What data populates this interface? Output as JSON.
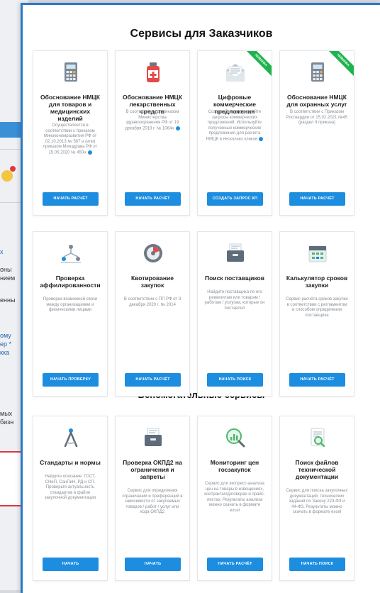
{
  "background": {
    "fragments": [
      "х",
      "оны",
      "нием",
      "енны",
      "ому",
      "ер *",
      "кка",
      "мых",
      "бизн"
    ]
  },
  "sections": {
    "main_title": "Сервисы для Заказчиков",
    "aux_title": "Вспомогательные сервисы"
  },
  "cards": [
    {
      "title": "Обоснование НМЦК для товаров и медицинских изделий",
      "desc": "Осуществляется в соответствии с приказом Минэкономразвития РФ от 02.10.2013 № 567 и (или) приказом Минздрава РФ от 15.05.2020 № 450н",
      "button": "НАЧАТЬ РАСЧЁТ",
      "icon": "calculator-icon",
      "ribbon": ""
    },
    {
      "title": "Обоснование НМЦК лекарственных средств",
      "desc": "В соответствии с приказом Министерства здравоохранения РФ от 19 декабря 2019 г. № 1064н",
      "button": "НАЧАТЬ РАСЧЁТ",
      "icon": "medicine-bottle-icon",
      "ribbon": ""
    },
    {
      "title": "Цифровые коммерческие предложения",
      "desc": "Создавайте и отправляйте запросы коммерческих предложений. Используйте полученные коммерческие предложения для расчета НМЦК в несколько кликов",
      "button": "СОЗДАТЬ ЗАПРОС КП",
      "icon": "envelope-icon",
      "ribbon": "НОВИНКА"
    },
    {
      "title": "Обоснование НМЦК для охранных услуг",
      "desc": "В соответствии с Приказом Росгвардии от 15.02.2021 №45 (раздел II приказа)",
      "button": "НАЧАТЬ РАСЧЁТ",
      "icon": "calculator-icon",
      "ribbon": "НОВИНКА"
    },
    {
      "title": "Проверка аффилированности",
      "desc": "Проверка возможной связи между организациями и физическими лицами",
      "button": "НАЧАТЬ ПРОВЕРКУ",
      "icon": "network-icon",
      "ribbon": ""
    },
    {
      "title": "Квотирование закупок",
      "desc": "В соответствии с ПП РФ от 3 декабря 2020 г. № 2014",
      "button": "НАЧАТЬ РАСЧЁТ",
      "icon": "pie-chart-icon",
      "ribbon": ""
    },
    {
      "title": "Поиск поставщиков",
      "desc": "Найдите поставщика по его реквизитам или товарам / работам / услугам, которые он поставлял",
      "button": "НАЧАТЬ ПОИСК",
      "icon": "file-box-icon",
      "ribbon": ""
    },
    {
      "title": "Калькулятор сроков закупки",
      "desc": "Сервис расчёта сроков закупки в соответствии с регламентом и способом определения поставщика",
      "button": "НАЧАТЬ РАСЧЁТ",
      "icon": "calendar-icon",
      "ribbon": ""
    },
    {
      "title": "Стандарты и нормы",
      "desc": "Найдите описание: ГОСТ, СНиП, СанПиН, РД и СП. Проверьте актуальность стандартов в файле закупочной документации",
      "button": "НАЧАТЬ",
      "icon": "compass-icon",
      "ribbon": ""
    },
    {
      "title": "Проверка ОКПД2 на ограничения и запреты",
      "desc": "Сервис для определения ограничений и преференций в зависимости от закупаемых товаров / работ / услуг или кода ОКПД2",
      "button": "НАЧАТЬ",
      "icon": "file-box-icon",
      "ribbon": ""
    },
    {
      "title": "Мониторинг цен госзакупок",
      "desc": "Сервис для экспресс-анализа цен на товары в извещениях, контрактах/договорах и прайс-листах. Результаты анализа можно скачать в формате excel",
      "button": "НАЧАТЬ РАСЧЁТ",
      "icon": "chart-magnifier-icon",
      "ribbon": ""
    },
    {
      "title": "Поиск файлов технической документации",
      "desc": "Сервис для поиска закупочных документаций, технических заданий по Закону 223-ФЗ и 44-ФЗ. Результаты можно скачать в формате excel",
      "button": "НАЧАТЬ ПОИСК",
      "icon": "document-search-icon",
      "ribbon": ""
    }
  ]
}
